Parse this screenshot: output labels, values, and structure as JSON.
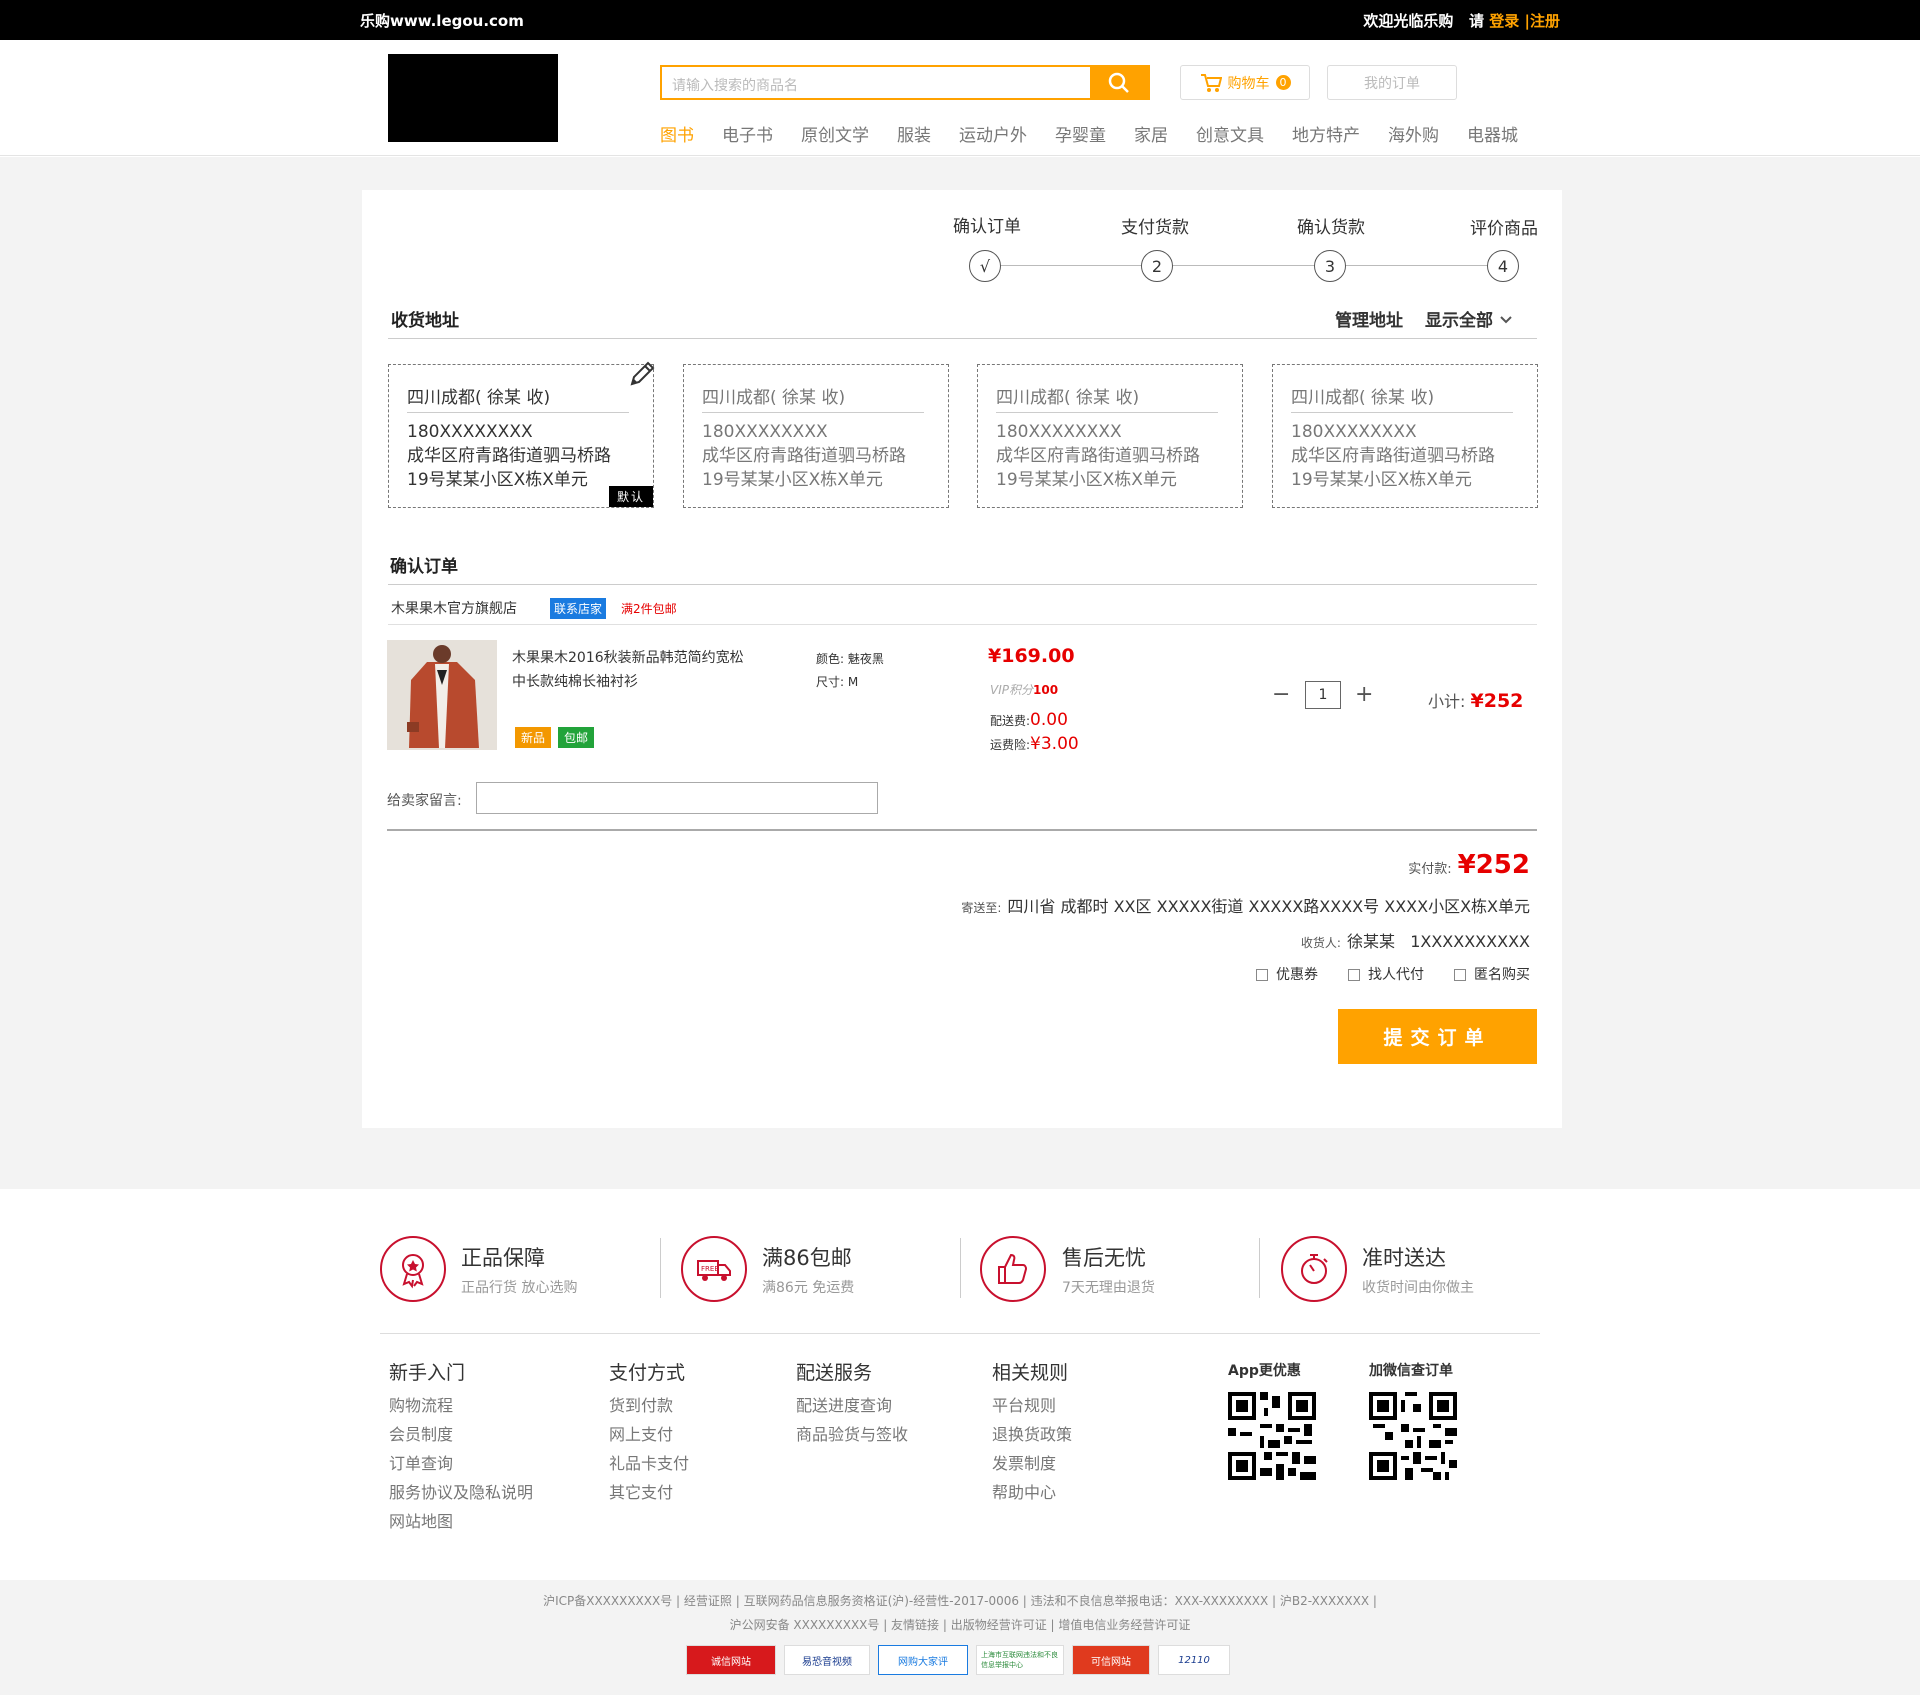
{
  "topbar": {
    "site": "乐购www.legou.com",
    "welcome": "欢迎光临乐购",
    "please": "请",
    "login": "登录",
    "sep": "|",
    "register": "注册"
  },
  "header": {
    "search_placeholder": "请输入搜索的商品名",
    "cart_label": "购物车",
    "cart_count": "0",
    "my_orders": "我的订单",
    "nav": [
      "图书",
      "电子书",
      "原创文学",
      "服装",
      "运动户外",
      "孕婴童",
      "家居",
      "创意文具",
      "地方特产",
      "海外购",
      "电器城"
    ]
  },
  "steps": [
    {
      "label": "确认订单",
      "mark": "√"
    },
    {
      "label": "支付货款",
      "mark": "2"
    },
    {
      "label": "确认货款",
      "mark": "3"
    },
    {
      "label": "评价商品",
      "mark": "4"
    }
  ],
  "address_section": {
    "title": "收货地址",
    "manage": "管理地址",
    "show_all": "显示全部",
    "cards": [
      {
        "name": "四川成都( 徐某 收)",
        "phone": "180XXXXXXXX",
        "line1": "成华区府青路街道驷马桥路",
        "line2": "19号某某小区X栋X单元",
        "default": "默认"
      },
      {
        "name": "四川成都( 徐某 收)",
        "phone": "180XXXXXXXX",
        "line1": "成华区府青路街道驷马桥路",
        "line2": "19号某某小区X栋X单元"
      },
      {
        "name": "四川成都( 徐某 收)",
        "phone": "180XXXXXXXX",
        "line1": "成华区府青路街道驷马桥路",
        "line2": "19号某某小区X栋X单元"
      },
      {
        "name": "四川成都( 徐某 收)",
        "phone": "180XXXXXXXX",
        "line1": "成华区府青路街道驷马桥路",
        "line2": "19号某某小区X栋X单元"
      }
    ]
  },
  "order_section": {
    "title": "确认订单",
    "store": "木果果木官方旗舰店",
    "contact": "联系店家",
    "promo": "满2件包邮",
    "product": {
      "name_line1": "木果果木2016秋装新品韩范简约宽松",
      "name_line2": "中长款纯棉长袖衬衫",
      "tag_new": "新品",
      "tag_free": "包邮",
      "color_label": "颜色:",
      "color_value": "魅夜黑",
      "size_label": "尺寸:",
      "size_value": "M",
      "price": "¥169.00",
      "vip_label": "VIP积分",
      "vip_value": "100",
      "shipping_label": "配送费:",
      "shipping_value": "0.00",
      "insurance_label": "运费险:",
      "insurance_value": "¥3.00",
      "qty": "1",
      "subtotal_label": "小计:",
      "subtotal_value": "¥252"
    },
    "message_label": "给卖家留言:"
  },
  "summary": {
    "paid_label": "实付款:",
    "paid_value": "¥252",
    "ship_to_label": "寄送至:",
    "ship_to_value": "四川省 成都时 XX区 XXXXX街道 XXXXX路XXXX号 XXXX小区X栋X单元",
    "receiver_label": "收货人:",
    "receiver_value": "徐某某   1XXXXXXXXXX",
    "options": [
      "优惠券",
      "找人代付",
      "匿名购买"
    ],
    "submit": "提交订单"
  },
  "features": [
    {
      "title": "正品保障",
      "sub": "正品行货  放心选购",
      "icon": "medal-icon"
    },
    {
      "title": "满86包邮",
      "sub": "满86元 免运费",
      "icon": "free-shipping-truck-icon"
    },
    {
      "title": "售后无忧",
      "sub": "7天无理由退货",
      "icon": "thumbs-up-icon"
    },
    {
      "title": "准时送达",
      "sub": "收货时间由你做主",
      "icon": "stopwatch-icon"
    }
  ],
  "footer_cols": [
    {
      "title": "新手入门",
      "items": [
        "购物流程",
        "会员制度",
        "订单查询",
        "服务协议及隐私说明",
        "网站地图"
      ]
    },
    {
      "title": "支付方式",
      "items": [
        "货到付款",
        "网上支付",
        "礼品卡支付",
        "其它支付"
      ]
    },
    {
      "title": "配送服务",
      "items": [
        "配送进度查询",
        "商品验货与签收"
      ]
    },
    {
      "title": "相关规则",
      "items": [
        "平台规则",
        "退换货政策",
        "发票制度",
        "帮助中心"
      ]
    }
  ],
  "qr": [
    {
      "label": "App更优惠"
    },
    {
      "label": "加微信查订单"
    }
  ],
  "icp": {
    "line1": "沪ICP备XXXXXXXXX号 | 经营证照 | 互联网药品信息服务资格证(沪)-经营性-2017-0006 | 违法和不良信息举报电话：XXX-XXXXXXXX | 沪B2-XXXXXXX |",
    "line2": "沪公网安备 XXXXXXXXX号 | 友情链接 | 出版物经营许可证 | 增值电信业务经营许可证"
  },
  "cert_badges": [
    "诚信网站",
    "易恐音视频",
    "网购大家评",
    "上海市互联网违法和不良信息举报中心",
    "可信网站",
    "12110"
  ],
  "colors": {
    "accent": "#ffa200",
    "price_red": "#e60000",
    "brand_red": "#c8102e",
    "link_blue": "#1a7be0",
    "tag_green": "#22a33a"
  }
}
